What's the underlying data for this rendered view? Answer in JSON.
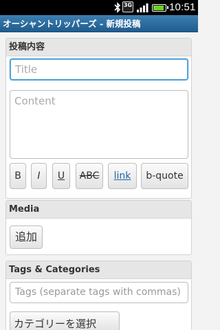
{
  "status_bar": {
    "network": "3G",
    "time": "10:51",
    "battery_level": 0.8,
    "icons": [
      "bluetooth-icon",
      "3g-icon",
      "signal-icon",
      "battery-icon"
    ]
  },
  "app_bar": {
    "title": "オーシャントリッパーズ - 新規投稿",
    "color": "#2f6fa3"
  },
  "post": {
    "heading": "投稿内容",
    "title_placeholder": "Title",
    "title_value": "",
    "content_placeholder": "Content",
    "content_value": "",
    "format_buttons": {
      "bold": "B",
      "italic": "I",
      "underline": "U",
      "strike": "ABC",
      "link": "link",
      "blockquote": "b-quote"
    }
  },
  "media": {
    "heading": "Media",
    "add_label": "追加"
  },
  "tags": {
    "heading": "Tags & Categories",
    "tags_placeholder": "Tags (separate tags with commas)",
    "tags_value": "",
    "category_button": "カテゴリーを選択"
  }
}
